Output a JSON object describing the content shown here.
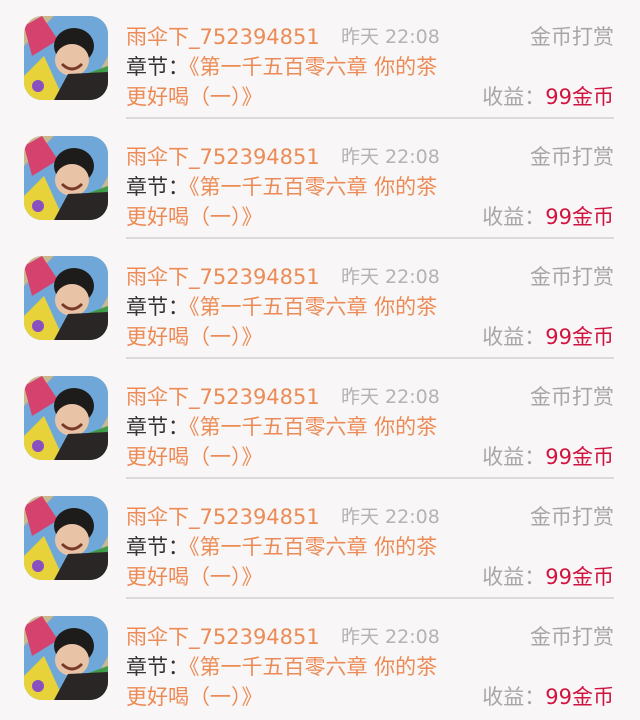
{
  "rewards": [
    {
      "user": "雨伞下_752394851",
      "time": "昨天 22:08",
      "type": "金币打赏",
      "chapter_label": "章节：",
      "chapter_line1": "《第一千五百零六章 你的茶",
      "chapter_line2": "更好喝（一）》",
      "income_label": "收益：",
      "income_value": "99金币"
    },
    {
      "user": "雨伞下_752394851",
      "time": "昨天 22:08",
      "type": "金币打赏",
      "chapter_label": "章节：",
      "chapter_line1": "《第一千五百零六章 你的茶",
      "chapter_line2": "更好喝（一）》",
      "income_label": "收益：",
      "income_value": "99金币"
    },
    {
      "user": "雨伞下_752394851",
      "time": "昨天 22:08",
      "type": "金币打赏",
      "chapter_label": "章节：",
      "chapter_line1": "《第一千五百零六章 你的茶",
      "chapter_line2": "更好喝（一）》",
      "income_label": "收益：",
      "income_value": "99金币"
    },
    {
      "user": "雨伞下_752394851",
      "time": "昨天 22:08",
      "type": "金币打赏",
      "chapter_label": "章节：",
      "chapter_line1": "《第一千五百零六章 你的茶",
      "chapter_line2": "更好喝（一）》",
      "income_label": "收益：",
      "income_value": "99金币"
    },
    {
      "user": "雨伞下_752394851",
      "time": "昨天 22:08",
      "type": "金币打赏",
      "chapter_label": "章节：",
      "chapter_line1": "《第一千五百零六章 你的茶",
      "chapter_line2": "更好喝（一）》",
      "income_label": "收益：",
      "income_value": "99金币"
    },
    {
      "user": "雨伞下_752394851",
      "time": "昨天 22:08",
      "type": "金币打赏",
      "chapter_label": "章节：",
      "chapter_line1": "《第一千五百零六章 你的茶",
      "chapter_line2": "更好喝（一）》",
      "income_label": "收益：",
      "income_value": "99金币"
    }
  ],
  "colors": {
    "accent": "#ec8b55",
    "income": "#d1143e",
    "muted": "#a8a6a6",
    "background": "#f8f6f6"
  },
  "icons": {
    "avatar": "user-avatar-photo"
  }
}
